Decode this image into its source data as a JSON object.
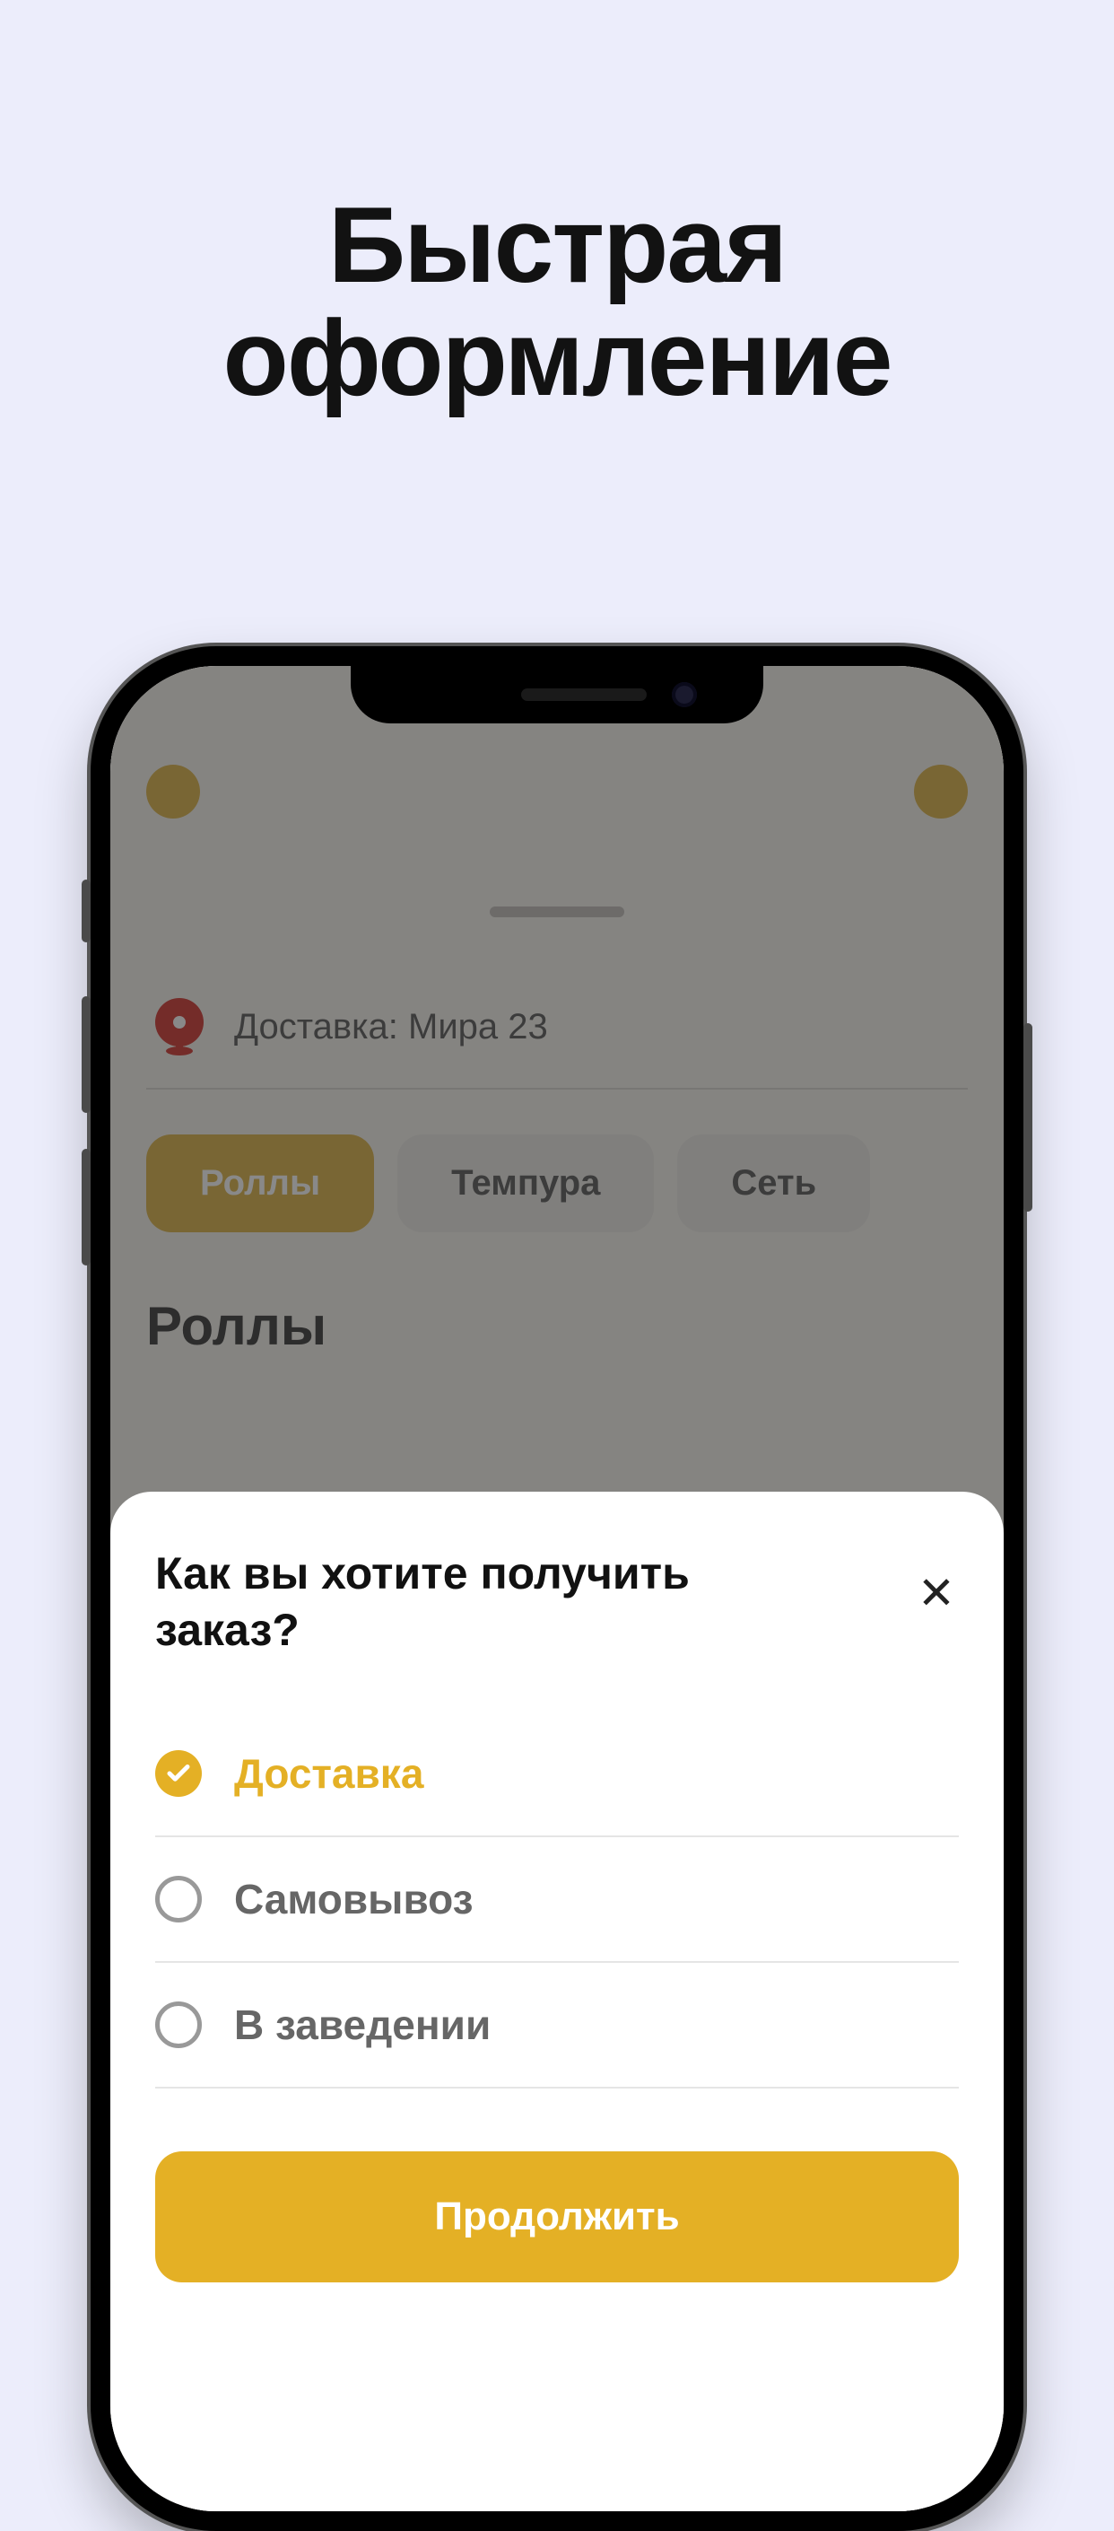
{
  "promo": {
    "title_line1": "Быстрая",
    "title_line2": "оформление"
  },
  "colors": {
    "accent": "#e4b025",
    "danger": "#d1312c"
  },
  "address": {
    "label": "Доставка: Мира 23"
  },
  "chips": [
    {
      "label": "Роллы",
      "active": true
    },
    {
      "label": "Темпура",
      "active": false
    },
    {
      "label": "Сеть",
      "active": false
    }
  ],
  "section": {
    "title": "Роллы"
  },
  "modal": {
    "title": "Как вы хотите получить заказ?",
    "close_glyph": "✕",
    "options": [
      {
        "label": "Доставка",
        "selected": true
      },
      {
        "label": "Самовывоз",
        "selected": false
      },
      {
        "label": "В заведении",
        "selected": false
      }
    ],
    "continue_label": "Продолжить"
  }
}
